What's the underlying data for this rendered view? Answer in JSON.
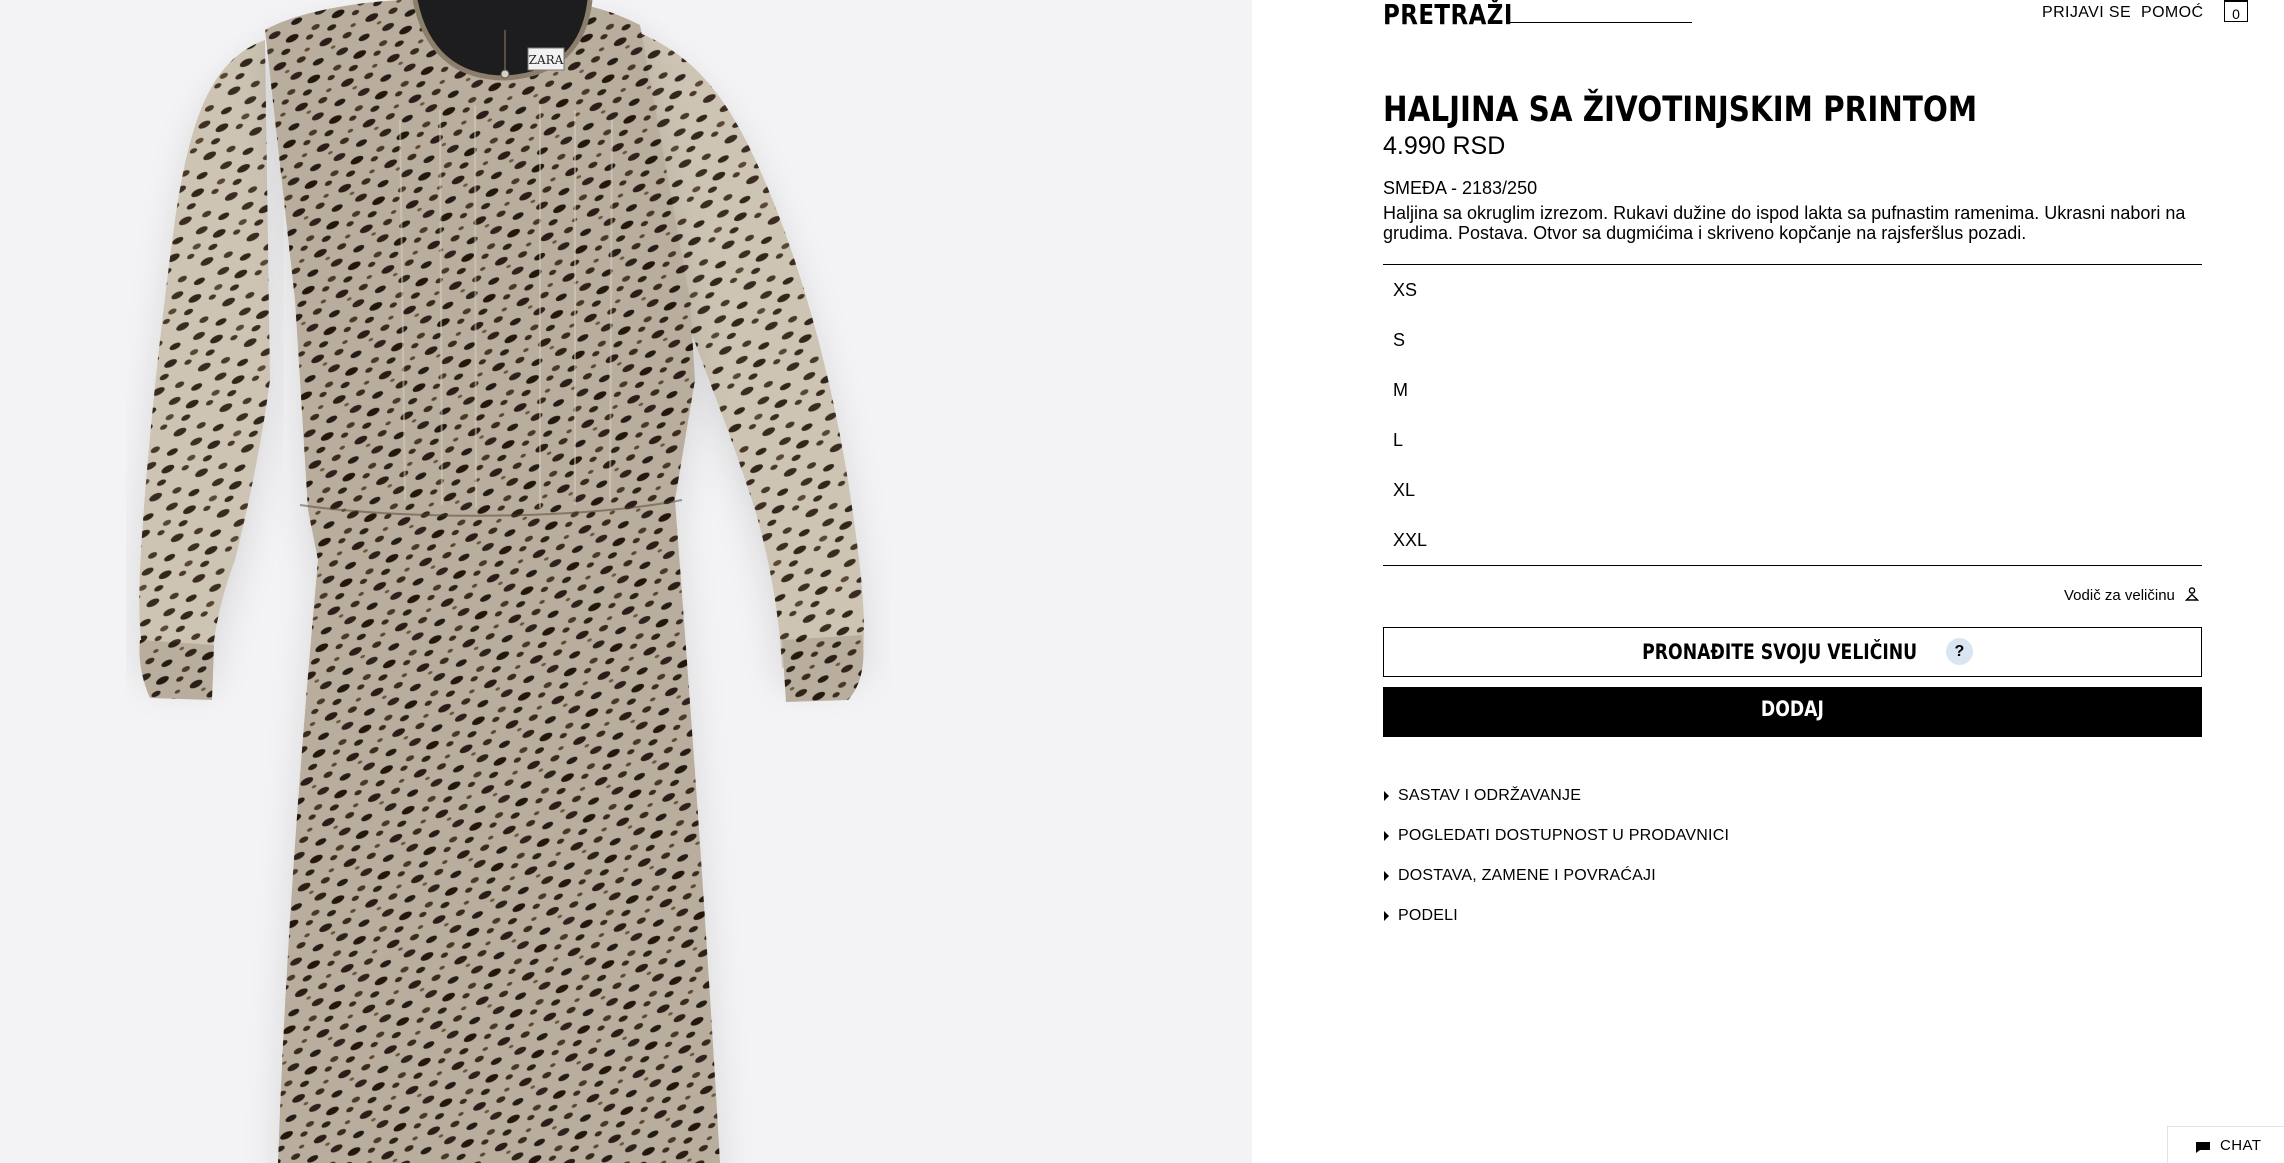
{
  "header": {
    "search_label": "PRETRAŽI",
    "login_label": "PRIJAVI SE",
    "help_label": "POMOĆ",
    "cart_count": "0"
  },
  "product": {
    "title": "HALJINA SA ŽIVOTINJSKIM PRINTOM",
    "price": "4.990 RSD",
    "color_ref": "SMEĐA - 2183/250",
    "description": "Haljina sa okruglim izrezom. Rukavi dužine do ispod lakta sa pufnastim ramenima. Ukrasni nabori na grudima. Postava. Otvor sa dugmićima i skriveno kopčanje na rajsferšlus pozadi.",
    "image_icon": "leopard-print-dress-photo",
    "brand_tag": "ZARA"
  },
  "sizes": [
    "XS",
    "S",
    "M",
    "L",
    "XL",
    "XXL"
  ],
  "size_guide_label": "Vodič za veličinu",
  "find_size_label": "PRONAĐITE SVOJU VELIČINU",
  "find_size_help": "?",
  "add_label": "DODAJ",
  "accordion": [
    "SASTAV I ODRŽAVANJE",
    "POGLEDATI DOSTUPNOST U PRODAVNICI",
    "DOSTAVA, ZAMENE I POVRAĆAJI",
    "PODELI"
  ],
  "chat_label": "CHAT",
  "colors": {
    "image_background": "#f3f3f5",
    "print_base": "#b8ad9c",
    "print_spot": "#2b2118",
    "help_badge": "#d9e6f2",
    "button_dark": "#000000"
  }
}
